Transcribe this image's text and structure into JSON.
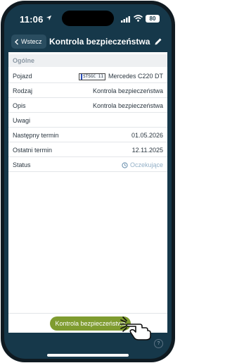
{
  "status_bar": {
    "time": "11:06",
    "battery": "80"
  },
  "header": {
    "back_label": "Wstecz",
    "title": "Kontrola bezpieczeństwa"
  },
  "section": {
    "title": "Ogólne"
  },
  "rows": [
    {
      "label": "Pojazd",
      "plate": "STSGC 11",
      "value": "Mercedes C220 DT"
    },
    {
      "label": "Rodzaj",
      "value": "Kontrola bezpieczeństwa"
    },
    {
      "label": "Opis",
      "value": "Kontrola bezpieczeństwa"
    },
    {
      "label": "Uwagi",
      "value": ""
    },
    {
      "label": "Następny termin",
      "value": "01.05.2026"
    },
    {
      "label": "Ostatni termin",
      "value": "12.11.2025"
    },
    {
      "label": "Status",
      "value": "Oczekujące"
    }
  ],
  "footer": {
    "action_label": "Kontrola bezpieczeństwa"
  },
  "help": {
    "label": "?"
  },
  "colors": {
    "header_bg": "#16384a",
    "action_green": "#7f9c30",
    "pending_blue": "#93b0c7"
  }
}
